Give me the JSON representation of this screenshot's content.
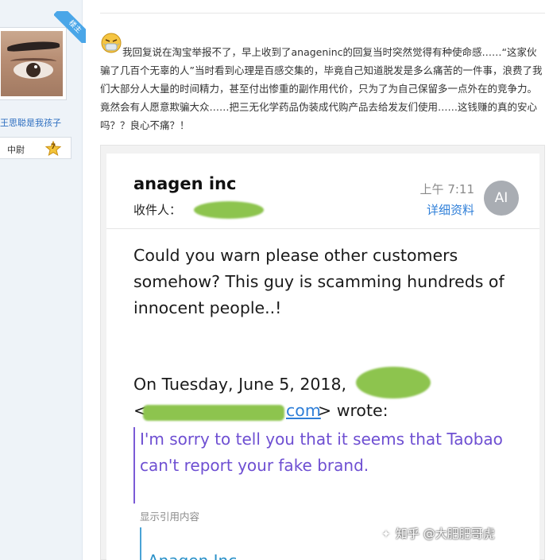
{
  "sidebar": {
    "corner_tag": "楼主",
    "username": "王思聪是我孩子",
    "rank": "中尉",
    "rank_level": "7"
  },
  "post": {
    "text": "我回复说在淘宝举报不了，早上收到了anageninc的回复当时突然觉得有种使命感……“这家伙骗了几百个无辜的人”当时看到心理是百感交集的，毕竟自己知道脱发是多么痛苦的一件事，浪费了我们大部分人大量的时间精力，甚至付出惨重的副作用代价，只为了为自己保留多一点外在的竞争力。竟然会有人愿意欺骗大众……把三无化学药品伪装成代购产品去给发友们使用……这钱赚的真的安心吗？？良心不痛？！"
  },
  "email": {
    "sender": "anagen inc",
    "to_label": "收件人：",
    "time": "上午 7:11",
    "details_link": "详细资料",
    "avatar_initials": "AI",
    "body": "Could you warn please other customers somehow? This guy is scamming hundreds of innocent people..!",
    "on_line": "On Tuesday, June 5, 2018,",
    "link_tail": "com",
    "wrote": "> wrote:",
    "lt": "<",
    "quote": "I'm sorry to tell you that it seems that Taobao can't report your fake brand.",
    "show_quoted": "显示引用内容",
    "quoted_sender": "Anagen Inc"
  },
  "watermark": "知乎 @大肥肥哥虎",
  "colors": {
    "link_blue": "#2f7fd8",
    "quote_purple": "#6e4fd2",
    "redaction_green": "#8dc44e",
    "sidebar_bg": "#eef3f8"
  }
}
